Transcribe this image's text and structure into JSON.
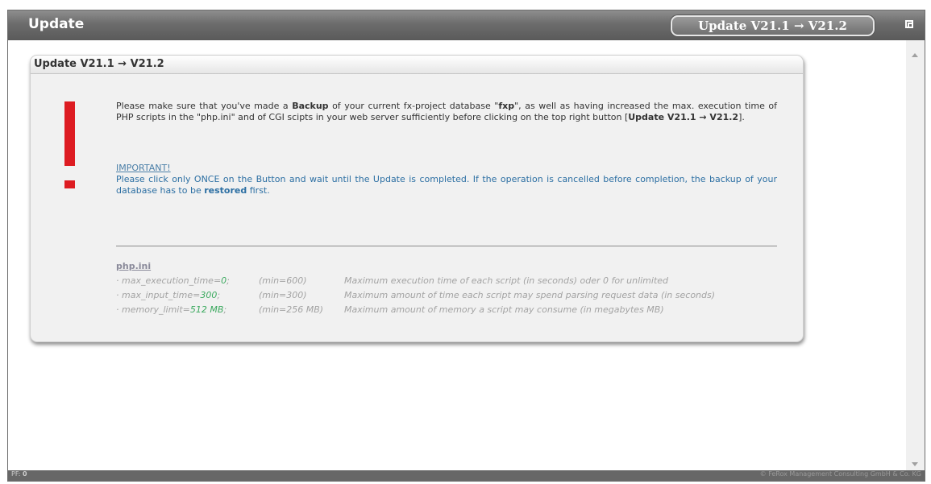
{
  "window": {
    "title": "Update",
    "update_button_label": "Update V21.1 → V21.2"
  },
  "panel": {
    "title": "Update V21.1 → V21.2",
    "msg_part1": "Please make sure that you've made a ",
    "msg_backup": "Backup",
    "msg_part2": " of your current fx-project database \"",
    "msg_db": "fxp",
    "msg_part3": "\", as well as having increased the max. execution time of PHP scripts in the \"php.ini\" and of CGI scipts in your web server sufficiently before clicking on the top right button [",
    "msg_button_ref": "Update V21.1 → V21.2",
    "msg_part4": "].",
    "important_label": "IMPORTANT!",
    "important_part1": "Please click only ONCE on the Button and wait until the Update is completed. If the operation is cancelled before completion, the backup of your database has to be ",
    "important_restored": "restored",
    "important_part2": " first.",
    "ini_title": "php.ini",
    "ini_rows": [
      {
        "prefix": "· max_execution_time=",
        "value": "0",
        "suffix": ";",
        "min": "(min=600)",
        "desc": "Maximum execution time of each script (in seconds) oder 0 for unlimited"
      },
      {
        "prefix": "· max_input_time=",
        "value": "300",
        "suffix": ";",
        "min": "(min=300)",
        "desc": "Maximum amount of time each script may spend parsing request data (in seconds)"
      },
      {
        "prefix": "· memory_limit=",
        "value": "512 MB",
        "suffix": ";",
        "min": "(min=256 MB)",
        "desc": "Maximum amount of memory a script may consume (in megabytes MB)"
      }
    ]
  },
  "statusbar": {
    "pf_label": "PF:",
    "pf_value": "0",
    "copyright": "© FeRox Management Consulting GmbH & Co. KG"
  },
  "colors": {
    "titlebar": "#6c6c6c",
    "exclamation": "#dd1c22",
    "important_text": "#2c6fa3",
    "ini_value": "#3ca95f"
  },
  "icons": {
    "corner": "maximize-icon",
    "warning": "exclamation-icon"
  }
}
